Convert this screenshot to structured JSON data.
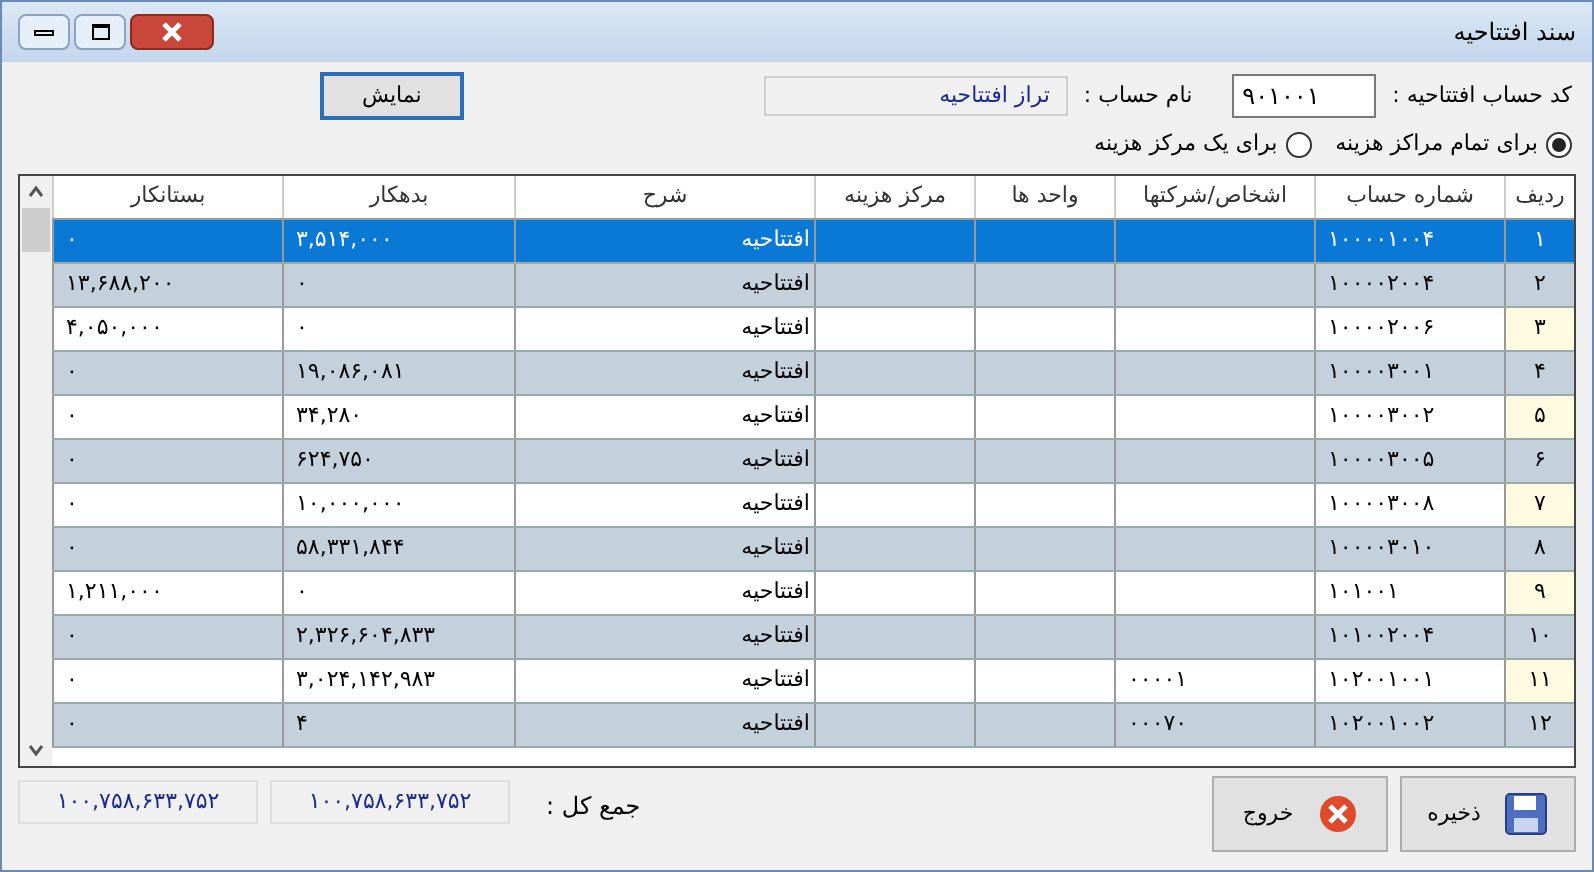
{
  "window": {
    "title": "سند افتتاحیه"
  },
  "header": {
    "code_label": "کد حساب افتتاحیه :",
    "code_value": "۹۰۱۰۰۱",
    "name_label": "نام حساب :",
    "name_value": "تراز افتتاحیه",
    "show_button": "نمایش"
  },
  "scope_options": [
    {
      "label": "برای تمام مراکز هزینه",
      "selected": true
    },
    {
      "label": "برای یک مرکز هزینه",
      "selected": false
    }
  ],
  "table": {
    "columns": [
      "ردیف",
      "شماره حساب",
      "اشخاص/شرکتها",
      "واحد ها",
      "مرکز هزینه",
      "شرح",
      "بدهکار",
      "بستانکار"
    ],
    "rows": [
      {
        "row": "۱",
        "account": "۱۰۰۰۰۱۰۰۴",
        "person": "",
        "desc": "افتتاحیه",
        "debit": "۳,۵۱۴,۰۰۰",
        "credit": "۰",
        "selected": true
      },
      {
        "row": "۲",
        "account": "۱۰۰۰۰۲۰۰۴",
        "person": "",
        "desc": "افتتاحیه",
        "debit": "۰",
        "credit": "۱۳,۶۸۸,۲۰۰",
        "selected": false
      },
      {
        "row": "۳",
        "account": "۱۰۰۰۰۲۰۰۶",
        "person": "",
        "desc": "افتتاحیه",
        "debit": "۰",
        "credit": "۴,۰۵۰,۰۰۰",
        "selected": false
      },
      {
        "row": "۴",
        "account": "۱۰۰۰۰۳۰۰۱",
        "person": "",
        "desc": "افتتاحیه",
        "debit": "۱۹,۰۸۶,۰۸۱",
        "credit": "۰",
        "selected": false
      },
      {
        "row": "۵",
        "account": "۱۰۰۰۰۳۰۰۲",
        "person": "",
        "desc": "افتتاحیه",
        "debit": "۳۴,۲۸۰",
        "credit": "۰",
        "selected": false
      },
      {
        "row": "۶",
        "account": "۱۰۰۰۰۳۰۰۵",
        "person": "",
        "desc": "افتتاحیه",
        "debit": "۶۲۴,۷۵۰",
        "credit": "۰",
        "selected": false
      },
      {
        "row": "۷",
        "account": "۱۰۰۰۰۳۰۰۸",
        "person": "",
        "desc": "افتتاحیه",
        "debit": "۱۰,۰۰۰,۰۰۰",
        "credit": "۰",
        "selected": false
      },
      {
        "row": "۸",
        "account": "۱۰۰۰۰۳۰۱۰",
        "person": "",
        "desc": "افتتاحیه",
        "debit": "۵۸,۳۳۱,۸۴۴",
        "credit": "۰",
        "selected": false
      },
      {
        "row": "۹",
        "account": "۱۰۱۰۰۱",
        "person": "",
        "desc": "افتتاحیه",
        "debit": "۰",
        "credit": "۱,۲۱۱,۰۰۰",
        "selected": false
      },
      {
        "row": "۱۰",
        "account": "۱۰۱۰۰۲۰۰۴",
        "person": "",
        "desc": "افتتاحیه",
        "debit": "۲,۳۲۶,۶۰۴,۸۳۳",
        "credit": "۰",
        "selected": false
      },
      {
        "row": "۱۱",
        "account": "۱۰۲۰۰۱۰۰۱",
        "person": "۰۰۰۰۱",
        "desc": "افتتاحیه",
        "debit": "۳,۰۲۴,۱۴۲,۹۸۳",
        "credit": "۰",
        "selected": false
      },
      {
        "row": "۱۲",
        "account": "۱۰۲۰۰۱۰۰۲",
        "person": "۰۰۰۷۰",
        "desc": "افتتاحیه",
        "debit": "۴",
        "credit": "۰",
        "selected": false
      }
    ]
  },
  "footer": {
    "total_label": "جمع کل :",
    "total_debit": "۱۰۰,۷۵۸,۶۳۳,۷۵۲",
    "total_credit": "۱۰۰,۷۵۸,۶۳۳,۷۵۲",
    "save_button": "ذخیره",
    "exit_button": "خروج"
  }
}
